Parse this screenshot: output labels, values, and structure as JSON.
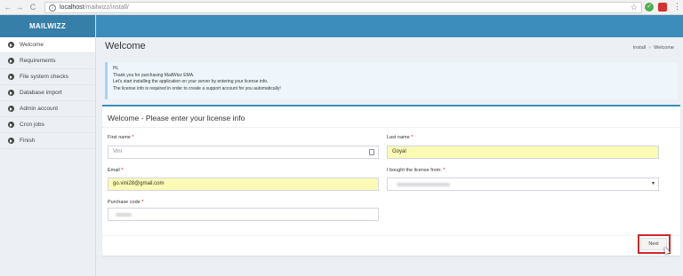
{
  "browser": {
    "url_host": "localhost",
    "url_path": "/mailwizz/install/",
    "nav": {
      "back": "←",
      "forward": "→",
      "reload": "C"
    },
    "ext1_glyph": "✓",
    "menu_glyph": "⋮",
    "star_glyph": "☆"
  },
  "sidebar": {
    "brand": "MAILWIZZ",
    "items": [
      {
        "label": "Welcome",
        "active": true
      },
      {
        "label": "Requirements"
      },
      {
        "label": "File system checks"
      },
      {
        "label": "Database import"
      },
      {
        "label": "Admin account"
      },
      {
        "label": "Cron jobs"
      },
      {
        "label": "Finish"
      }
    ]
  },
  "page": {
    "title": "Welcome",
    "breadcrumb": [
      "Install",
      "Welcome"
    ],
    "breadcrumb_sep": "»"
  },
  "callout": {
    "lines": [
      "Hi,",
      "Thank you for purchasing MailWizz EMA.",
      "Let's start installing the application on your server by entering your license info.",
      "The license info is required in order to create a support account for you automatically!"
    ]
  },
  "form": {
    "title": "Welcome - Please enter your license info",
    "required_mark": "*",
    "first_name": {
      "label": "First name",
      "value": "Vini"
    },
    "last_name": {
      "label": "Last name",
      "value": "Goyal"
    },
    "email": {
      "label": "Email",
      "value": "go.vini28@gmail.com"
    },
    "bought_from": {
      "label": "I bought the license from:",
      "caret": "▼"
    },
    "purchase_code": {
      "label": "Purchase code"
    },
    "next_label": "Next"
  },
  "colors": {
    "brand": "#367fa9",
    "topbar": "#3c8dbc",
    "autofill": "#fbfbb5",
    "highlight": "#d0282a"
  }
}
